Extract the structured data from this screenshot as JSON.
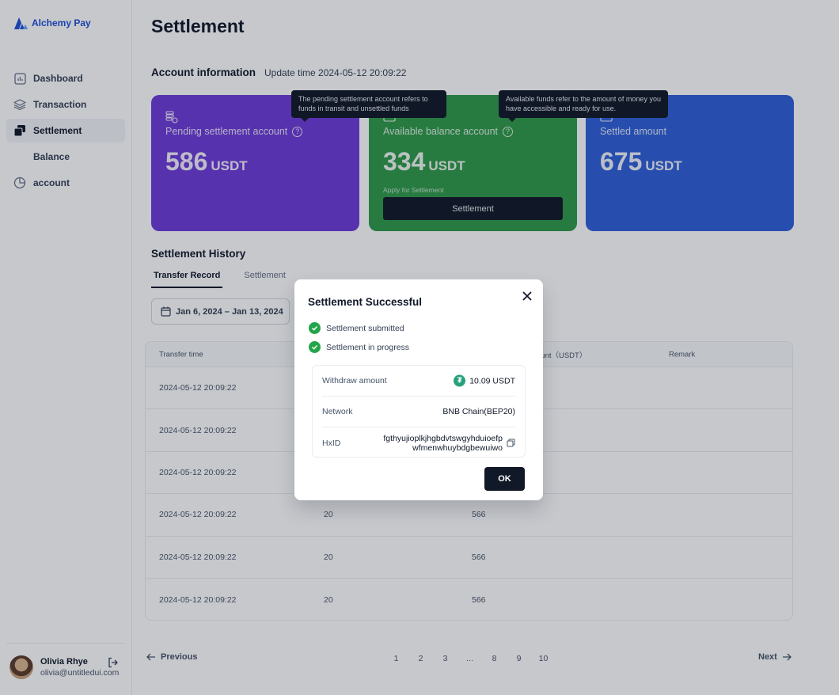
{
  "app": {
    "name": "Alchemy Pay"
  },
  "sidebar": {
    "items": [
      {
        "label": "Dashboard"
      },
      {
        "label": "Transaction"
      },
      {
        "label": "Settlement"
      },
      {
        "label": "Balance"
      },
      {
        "label": "account"
      }
    ],
    "user": {
      "name": "Olivia Rhye",
      "email": "olivia@untitledui.com"
    }
  },
  "page": {
    "title": "Settlement",
    "account_title": "Account information",
    "update_time": "Update time 2024-05-12 20:09:22"
  },
  "cards": {
    "pending": {
      "label": "Pending settlement account",
      "value": "586",
      "unit": "USDT",
      "tooltip": "The pending settlement account refers to funds in transit and unsettled funds"
    },
    "available": {
      "label": "Available balance account",
      "value": "334",
      "unit": "USDT",
      "tooltip": "Available funds refer to the amount of money you have accessible and ready for use.",
      "apply_label": "Apply for Settlement",
      "button": "Settlement"
    },
    "settled": {
      "label": "Settled amount",
      "value": "675",
      "unit": "USDT"
    }
  },
  "history": {
    "title": "Settlement History",
    "tabs": [
      "Transfer Record",
      "Settlement"
    ],
    "date_range": "Jan 6, 2024 – Jan 13, 2024",
    "columns": [
      "Transfer time",
      "",
      "ount（USDT）",
      "Remark"
    ],
    "rows": [
      {
        "time": "2024-05-12 20:09:22",
        "a": "",
        "b": ""
      },
      {
        "time": "2024-05-12 20:09:22",
        "a": "",
        "b": ""
      },
      {
        "time": "2024-05-12 20:09:22",
        "a": "",
        "b": ""
      },
      {
        "time": "2024-05-12 20:09:22",
        "a": "20",
        "b": "566"
      },
      {
        "time": "2024-05-12 20:09:22",
        "a": "20",
        "b": "566"
      },
      {
        "time": "2024-05-12 20:09:22",
        "a": "20",
        "b": "566"
      }
    ]
  },
  "pagination": {
    "previous": "Previous",
    "next": "Next",
    "pages": [
      "1",
      "2",
      "3",
      "...",
      "8",
      "9",
      "10"
    ]
  },
  "modal": {
    "title": "Settlement Successful",
    "steps": [
      "Settlement submitted",
      "Settlement in progress"
    ],
    "withdraw_label": "Withdraw amount",
    "withdraw_value": "10.09 USDT",
    "network_label": "Network",
    "network_value": "BNB Chain(BEP20)",
    "hxid_label": "HxID",
    "hxid_line1": "fgthyujioplkjhgbdvtswgyhduioefp",
    "hxid_line2": "wfmenwhuybdgbewuiwo",
    "ok": "OK"
  },
  "colors": {
    "purple_card": "#6d3bd8",
    "green_card": "#2f9a48",
    "blue_card": "#2f5fd8",
    "success": "#22a54a"
  }
}
